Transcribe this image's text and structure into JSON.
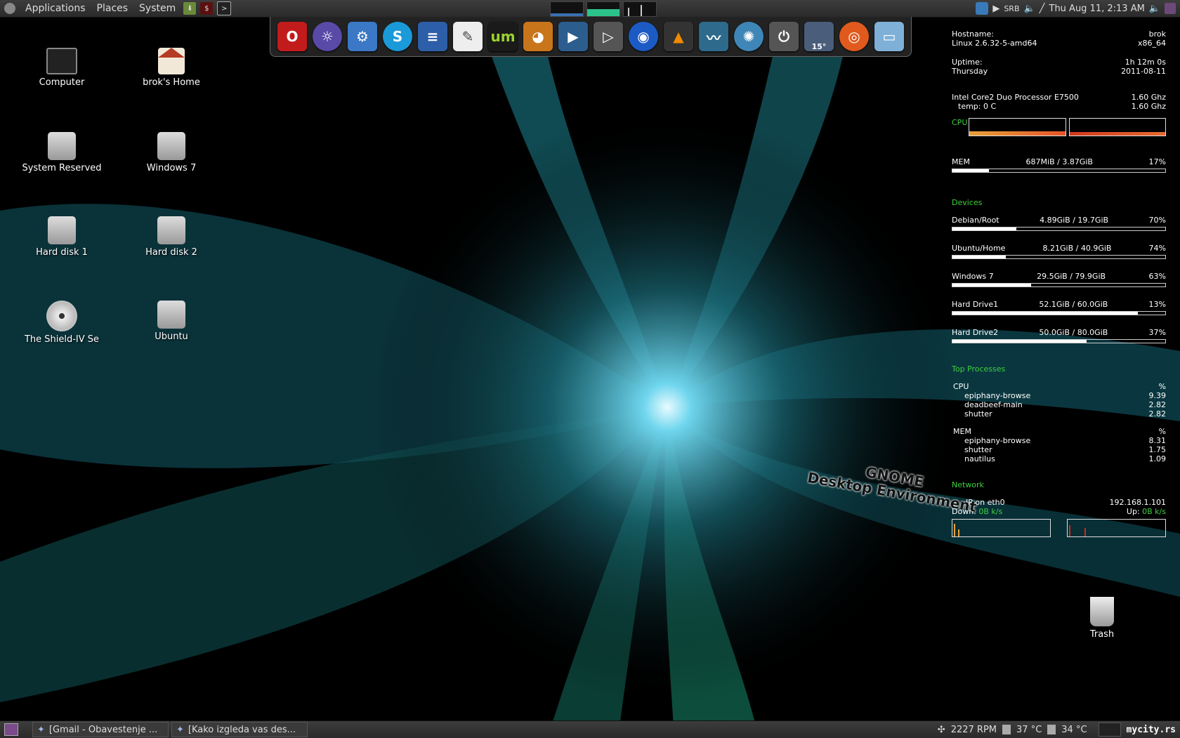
{
  "top_panel": {
    "menus": [
      "Applications",
      "Places",
      "System"
    ],
    "tray": {
      "keyboard_layout": "SRB",
      "datetime": "Thu Aug 11,  2:13 AM"
    }
  },
  "dock": {
    "icons": [
      "opera-icon",
      "browser-icon",
      "settings-icon",
      "skype-icon",
      "writer-icon",
      "text-editor-icon",
      "um-icon",
      "gimp-icon",
      "video-player-icon",
      "play-icon",
      "google-earth-icon",
      "vlc-icon",
      "system-monitor-icon",
      "shutter-icon",
      "power-icon",
      "weather-icon",
      "ubuntu-icon",
      "folder-icon"
    ],
    "weather_temp": "15°"
  },
  "desktop": {
    "icons": [
      {
        "label": "Computer",
        "icon": "computer-icon"
      },
      {
        "label": "brok's Home",
        "icon": "home-icon"
      },
      {
        "label": "System Reserved",
        "icon": "drive-icon"
      },
      {
        "label": "Windows 7",
        "icon": "drive-icon"
      },
      {
        "label": "Hard disk 1",
        "icon": "drive-icon"
      },
      {
        "label": "Hard disk 2",
        "icon": "drive-icon"
      },
      {
        "label": "The Shield-IV Se",
        "icon": "dvd-icon"
      },
      {
        "label": "Ubuntu",
        "icon": "drive-icon"
      }
    ],
    "trash_label": "Trash"
  },
  "conky": {
    "hostname_label": "Hostname:",
    "hostname": "brok",
    "kernel": "Linux 2.6.32-5-amd64",
    "arch": "x86_64",
    "uptime_label": "Uptime:",
    "uptime": "1h 12m 0s",
    "day": "Thursday",
    "date": "2011-08-11",
    "cpu_model": "Intel Core2 Duo Processor E7500",
    "cpu_freq1": "1.60 Ghz",
    "temp": "temp: 0 C",
    "cpu_freq2": "1.60 Ghz",
    "cpu_label": "CPU",
    "mem_label": "MEM",
    "mem_value": "687MiB / 3.87GiB",
    "mem_percent": "17%",
    "mem_fraction": 0.17,
    "devices_label": "Devices",
    "devices": [
      {
        "name": "Debian/Root",
        "usage": "4.89GiB / 19.7GiB",
        "percent": "70%",
        "fill": 0.3
      },
      {
        "name": "Ubuntu/Home",
        "usage": "8.21GiB / 40.9GiB",
        "percent": "74%",
        "fill": 0.25
      },
      {
        "name": "Windows 7",
        "usage": "29.5GiB / 79.9GiB",
        "percent": "63%",
        "fill": 0.37
      },
      {
        "name": "Hard Drive1",
        "usage": "52.1GiB / 60.0GiB",
        "percent": "13%",
        "fill": 0.87
      },
      {
        "name": "Hard Drive2",
        "usage": "50.0GiB / 80.0GiB",
        "percent": "37%",
        "fill": 0.63
      }
    ],
    "top_processes_label": "Top Processes",
    "cpu_proc_header": "CPU",
    "percent_header": "%",
    "cpu_procs": [
      {
        "name": "epiphany-browse",
        "value": "9.39"
      },
      {
        "name": "deadbeef-main",
        "value": "2.82"
      },
      {
        "name": "shutter",
        "value": "2.82"
      }
    ],
    "mem_proc_header": "MEM",
    "mem_procs": [
      {
        "name": "epiphany-browse",
        "value": "8.31"
      },
      {
        "name": "shutter",
        "value": "1.75"
      },
      {
        "name": "nautilus",
        "value": "1.09"
      }
    ],
    "network_label": "Network",
    "ip_label": "IP on eth0",
    "ip": "192.168.1.101",
    "down_label": "Down:",
    "down_value": "0B  k/s",
    "up_label": "Up:",
    "up_value": "0B  k/s"
  },
  "gnome_text": {
    "line1": "GNOME",
    "line2": "Desktop Environment"
  },
  "bottom_panel": {
    "tasks": [
      {
        "label": "[Gmail - Obavestenje ..."
      },
      {
        "label": "[Kako izgleda vas des..."
      }
    ],
    "fan": "2227 RPM",
    "temp1": "37 °C",
    "temp2": "34 °C",
    "watermark": "mycity.rs"
  }
}
